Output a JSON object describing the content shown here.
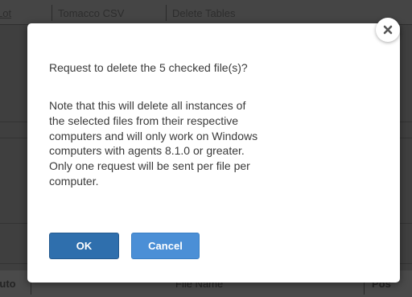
{
  "background": {
    "top_labels": [
      "Lot",
      "Tomacco CSV",
      "Delete Tables"
    ],
    "footer_labels": [
      "Auto",
      "File Name",
      "Pos"
    ]
  },
  "dialog": {
    "close_icon": "close-icon",
    "title": "Request to delete the 5 checked file(s)?",
    "body_lines": [
      "Note that this will delete all instances of",
      "the selected files from their respective",
      "computers and will only work on Windows",
      "computers with agents 8.1.0 or greater.",
      "Only one request will be sent per file per",
      "computer."
    ],
    "ok_label": "OK",
    "cancel_label": "Cancel"
  },
  "colors": {
    "overlay": "#3f3f3f",
    "dialog_bg": "#ffffff",
    "primary_button": "#2f6fad",
    "secondary_button": "#4b8fd6",
    "text": "#3a3a3a"
  }
}
